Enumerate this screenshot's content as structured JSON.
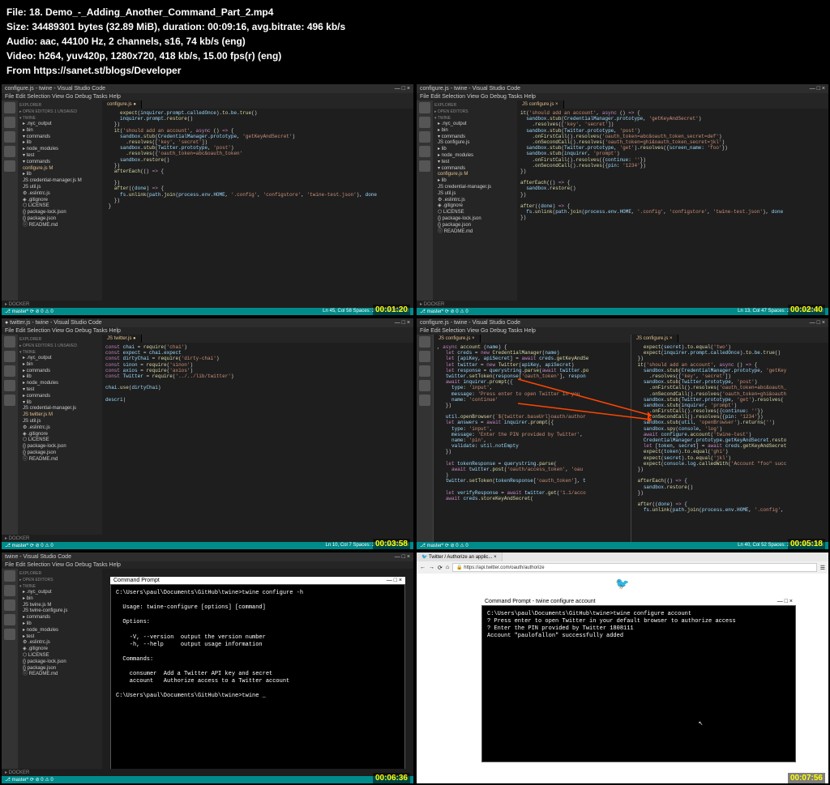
{
  "header": {
    "file": "18. Demo_-_Adding_Another_Command_Part_2.mp4",
    "size": "34489301 bytes (32.89 MiB), duration: 00:09:16, avg.bitrate: 496 kb/s",
    "audio": "aac, 44100 Hz, 2 channels, s16, 74 kb/s (eng)",
    "video": "h264, yuv420p, 1280x720, 418 kb/s, 15.00 fps(r) (eng)",
    "from": "https://sanet.st/blogs/Developer"
  },
  "panes": {
    "p1": {
      "title": "configure.js - twine - Visual Studio Code",
      "menu": "File  Edit  Selection  View  Go  Debug  Tasks  Help",
      "tab": "configure.js ●",
      "explorer": "EXPLORER",
      "sect1": "▸ OPEN EDITORS  1 UNSAVED",
      "sect2": "▾ TWINE",
      "tree": [
        "▸ .nyc_output",
        "▸ bin",
        "▾ commands",
        "▸ lib",
        "▸ node_modules",
        "▾ test",
        "  ▾ commands",
        "    configure.js    M",
        "  ▸ lib",
        "  JS credential-manager.js  M",
        "  JS util.js",
        "⚙ .eslintrc.js",
        "◈ .gitignore",
        "⬡ LICENSE",
        "{} package-lock.json",
        "{} package.json",
        "ⓘ README.md"
      ],
      "code": "     <span class='fn'>expect</span>(<span class='id'>inquirer</span>.<span class='id'>prompt</span>.<span class='id'>calledOnce</span>).<span class='fn'>to</span>.<span class='id'>be</span>.<span class='fn'>true</span>()\n     <span class='id'>inquirer</span>.<span class='id'>prompt</span>.<span class='fn'>restore</span>()\n   })\n   <span class='fn'>it</span>(<span class='str'>'should add an account'</span>, <span class='kw'>async</span> () <span class='kw'>=></span> {\n     <span class='id'>sandbox</span>.<span class='fn'>stub</span>(<span class='id'>CredentialManager</span>.<span class='id'>prototype</span>, <span class='str'>'getKeyAndSecret'</span>)\n       .<span class='fn'>resolves</span>([<span class='str'>'key'</span>, <span class='str'>'secret'</span>])\n     <span class='id'>sandbox</span>.<span class='fn'>stub</span>(<span class='id'>Twitter</span>.<span class='id'>prototype</span>, <span class='str'>'post'</span>)\n       .<span class='fn'>resolves</span>({<span class='str'>'oauth_token=abc&oauth_token'</span>\n     <span class='id'>sandbox</span>.<span class='fn'>restore</span>()\n   })\n   <span class='fn'>afterEach</span>(() <span class='kw'>=></span> {\n\n   })\n   <span class='fn'>after</span>((<span class='id'>done</span>) <span class='kw'>=></span> {\n     <span class='id'>fs</span>.<span class='fn'>unlink</span>(<span class='id'>path</span>.<span class='fn'>join</span>(<span class='id'>process</span>.<span class='id'>env</span>.<span class='id'>HOME</span>, <span class='str'>'.config'</span>, <span class='str'>'configstore'</span>, <span class='str'>'twine-test.json'</span>), <span class='id'>done</span>\n   })\n }",
      "status_l": "⎇ master* ⟳ ⊘ 0 ⚠ 0",
      "status_r": "Ln 45, Col 58   Spaces: 2  UTF-8  CRLF ☺",
      "docker": "▸ DOCKER",
      "ts": "00:01:20"
    },
    "p2": {
      "title": "configure.js - twine - Visual Studio Code",
      "menu": "File  Edit  Selection  View  Go  Debug  Tasks  Help",
      "tab": "JS configure.js ×",
      "explorer": "EXPLORER",
      "sect1": "▸ OPEN EDITORS",
      "sect2": "▾ TWINE",
      "tree": [
        "▸ .nyc_output",
        "▸ bin",
        "▾ commands",
        "  JS configure.js",
        "▸ lib",
        "▸ node_modules",
        "▾ test",
        "  ▾ commands",
        "    configure.js    M",
        "  ▸ lib",
        "  JS credential-manager.js",
        "  JS util.js",
        "⚙ .eslintrc.js",
        "◈ .gitignore",
        "⬡ LICENSE",
        "{} package-lock.json",
        "{} package.json",
        "ⓘ README.md"
      ],
      "code": "<span class='fn'>it</span>(<span class='str'>'should add an account'</span>, <span class='kw'>async</span> () <span class='kw'>=></span> {\n  <span class='id'>sandbox</span>.<span class='fn'>stub</span>(<span class='id'>CredentialManager</span>.<span class='id'>prototype</span>, <span class='str'>'getKeyAndSecret'</span>)\n    .<span class='fn'>resolves</span>([<span class='str'>'key'</span>, <span class='str'>'secret'</span>])\n  <span class='id'>sandbox</span>.<span class='fn'>stub</span>(<span class='id'>Twitter</span>.<span class='id'>prototype</span>, <span class='str'>'post'</span>)\n    .<span class='fn'>onFirstCall</span>().<span class='fn'>resolves</span>(<span class='str'>'oauth_token=abc&oauth_token_secret=def'</span>)\n    .<span class='fn'>onSecondCall</span>().<span class='fn'>resolves</span>(<span class='str'>'oauth_token=ghi&oauth_token_secret=jkl'</span>)\n  <span class='id'>sandbox</span>.<span class='fn'>stub</span>(<span class='id'>Twitter</span>.<span class='id'>prototype</span>, <span class='str'>'get'</span>).<span class='fn'>resolves</span>({<span class='id'>screen_name</span>: <span class='str'>'foo'</span>})\n  <span class='id'>sandbox</span>.<span class='fn'>stub</span>(<span class='id'>inquirer</span>, <span class='str'>'prompt'</span>)\n    .<span class='fn'>onFirstCall</span>().<span class='fn'>resolves</span>({<span class='id'>continue</span>: <span class='str'>''</span>})\n    .<span class='fn'>onSecondCall</span>().<span class='fn'>resolves</span>({<span class='id'>pin</span>: <span class='str'>'1234'</span>})\n})\n\n<span class='fn'>afterEach</span>(() <span class='kw'>=></span> {\n  <span class='id'>sandbox</span>.<span class='fn'>restore</span>()\n})\n\n<span class='fn'>after</span>((<span class='id'>done</span>) <span class='kw'>=></span> {\n  <span class='id'>fs</span>.<span class='fn'>unlink</span>(<span class='id'>path</span>.<span class='fn'>join</span>(<span class='id'>process</span>.<span class='id'>env</span>.<span class='id'>HOME</span>, <span class='str'>'.config'</span>, <span class='str'>'configstore'</span>, <span class='str'>'twine-test.json'</span>), <span class='id'>done</span>\n})",
      "status_l": "⎇ master* ⟳ ⊘ 0 ⚠ 0",
      "status_r": "Ln 13, Col 47   Spaces: 2  UTF-8  CRLF ☺",
      "docker": "▸ DOCKER",
      "ts": "00:02:40"
    },
    "p3": {
      "title": "● twitter.js - twine - Visual Studio Code",
      "menu": "File  Edit  Selection  View  Go  Debug  Tasks  Help",
      "tab": "JS twitter.js ●",
      "explorer": "EXPLORER",
      "sect1": "▸ OPEN EDITORS  1 UNSAVED",
      "sect2": "▾ TWINE",
      "tree": [
        "▸ .nyc_output",
        "▸ bin",
        "▸ commands",
        "▸ lib",
        "▸ node_modules",
        "▾ test",
        "  ▸ commands",
        "  ▾ lib",
        "    JS credential-manager.js",
        "    JS twitter.js    M",
        "  JS util.js",
        "⚙ .eslintrc.js",
        "◈ .gitignore",
        "⬡ LICENSE",
        "{} package-lock.json",
        "{} package.json",
        "ⓘ README.md"
      ],
      "code": "<span class='kw'>const</span> <span class='id'>chai</span> = <span class='fn'>require</span>(<span class='str'>'chai'</span>)\n<span class='kw'>const</span> <span class='id'>expect</span> = <span class='id'>chai</span>.<span class='id'>expect</span>\n<span class='kw'>const</span> <span class='id'>dirtyChai</span> = <span class='fn'>require</span>(<span class='str'>'dirty-chai'</span>)\n<span class='kw'>const</span> <span class='id'>sinon</span> = <span class='fn'>require</span>(<span class='str'>'sinon'</span>)\n<span class='kw'>const</span> <span class='id'>axios</span> = <span class='fn'>require</span>(<span class='str'>'axios'</span>)\n<span class='kw'>const</span> <span class='id'>Twitter</span> = <span class='fn'>require</span>(<span class='str'>'../../lib/twitter'</span>)\n\n<span class='id'>chai</span>.<span class='fn'>use</span>(<span class='id'>dirtyChai</span>)\n\n<span class='id'>descri</span>|",
      "status_l": "⎇ master* ⟳ ⊘ 0 ⚠ 0",
      "status_r": "Ln 10, Col 7   Spaces: 2  UTF-8  CRLF ☺",
      "docker": "▸ DOCKER",
      "ts": "00:03:58"
    },
    "p4": {
      "title": "configure.js - twine - Visual Studio Code",
      "menu": "File  Edit  Selection  View  Go  Debug  Tasks  Help",
      "tab1": "JS configure.js ×",
      "tab2": "JS configure.js ×",
      "code1": ", <span class='kw'>async</span> <span class='fn'>account</span> (<span class='id'>name</span>) {\n   <span class='kw'>let</span> <span class='id'>creds</span> = <span class='kw'>new</span> <span class='fn'>CredentialManager</span>(<span class='id'>name</span>)\n   <span class='kw'>let</span> [<span class='id'>apiKey</span>, <span class='id'>apiSecret</span>] = <span class='kw'>await</span> <span class='id'>creds</span>.<span class='fn'>getKeyAndSe</span>\n   <span class='kw'>let</span> <span class='id'>twitter</span> = <span class='kw'>new</span> <span class='fn'>Twitter</span>(<span class='id'>apiKey</span>, <span class='id'>apiSecret</span>)\n   <span class='kw'>let</span> <span class='id'>response</span> = <span class='id'>querystring</span>.<span class='fn'>parse</span>(<span class='kw'>await</span> <span class='id'>twitter</span>.<span class='fn'>po</span>\n   <span class='id'>twitter</span>.<span class='fn'>setToken</span>(<span class='id'>response</span>[<span class='str'>'oauth_token'</span>], <span class='id'>respon</span>\n   <span class='kw'>await</span> <span class='id'>inquirer</span>.<span class='fn'>prompt</span>({\n     <span class='id'>type</span>: <span class='str'>'input'</span>,\n     <span class='id'>message</span>: <span class='str'>'Press enter to open Twitter in you</span>\n     <span class='id'>name</span>: <span class='str'>'continue'</span>\n   })\n\n   <span class='id'>util</span>.<span class='fn'>openBrowser</span>(<span class='str'>`${twitter.baseUrl}oauth/author</span>\n   <span class='kw'>let</span> <span class='id'>answers</span> = <span class='kw'>await</span> <span class='id'>inquirer</span>.<span class='fn'>prompt</span>({\n     <span class='id'>type</span>: <span class='str'>'input'</span>,\n     <span class='id'>message</span>: <span class='str'>'Enter the PIN provided by Twitter'</span>,\n     <span class='id'>name</span>: <span class='str'>'pin'</span>,\n     <span class='id'>validate</span>: <span class='id'>util</span>.<span class='id'>notEmpty</span>\n   })\n\n   <span class='kw'>let</span> <span class='id'>tokenResponse</span> = <span class='id'>querystring</span>.<span class='fn'>parse</span>(\n     <span class='kw'>await</span> <span class='id'>twitter</span>.<span class='fn'>post</span>(<span class='str'>'oauth/access_token'</span>, <span class='str'>'oau</span>\n   )\n   <span class='id'>twitter</span>.<span class='fn'>setToken</span>(<span class='id'>tokenResponse</span>[<span class='str'>'oauth_token'</span>], <span class='id'>t</span>\n\n   <span class='kw'>let</span> <span class='id'>verifyResponse</span> = <span class='kw'>await</span> <span class='id'>twitter</span>.<span class='fn'>get</span>(<span class='str'>'1.1/acco</span>\n   <span class='kw'>await</span> <span class='id'>creds</span>.<span class='fn'>storeKeyAndSecret</span>(",
      "code2": "   <span class='fn'>expect</span>(<span class='id'>secret</span>).<span class='fn'>to</span>.<span class='fn'>equal</span>(<span class='str'>'two'</span>)\n   <span class='fn'>expect</span>(<span class='id'>inquirer</span>.<span class='id'>prompt</span>.<span class='id'>calledOnce</span>).<span class='fn'>to</span>.<span class='id'>be</span>.<span class='fn'>true</span>()\n })\n <span class='fn'>it</span>(<span class='str'>'should add an account'</span>, <span class='kw'>async</span> () <span class='kw'>=></span> {\n   <span class='id'>sandbox</span>.<span class='fn'>stub</span>(<span class='id'>CredentialManager</span>.<span class='id'>prototype</span>, <span class='str'>'getKey</span>\n     .<span class='fn'>resolves</span>([<span class='str'>'key'</span>, <span class='str'>'secret'</span>])\n   <span class='id'>sandbox</span>.<span class='fn'>stub</span>(<span class='id'>Twitter</span>.<span class='id'>prototype</span>, <span class='str'>'post'</span>)\n     .<span class='fn'>onFirstCall</span>().<span class='fn'>resolves</span>(<span class='str'>'oauth_token=abc&oauth_</span>\n     .<span class='fn'>onSecondCall</span>().<span class='fn'>resolves</span>(<span class='str'>'oauth_token=ghi&oauth</span>\n   <span class='id'>sandbox</span>.<span class='fn'>stub</span>(<span class='id'>Twitter</span>.<span class='id'>prototype</span>, <span class='str'>'get'</span>).<span class='fn'>resolves</span>(\n   <span class='id'>sandbox</span>.<span class='fn'>stub</span>(<span class='id'>inquirer</span>, <span class='str'>'prompt'</span>)\n     .<span class='fn'>onFirstCall</span>().<span class='fn'>resolves</span>({<span class='id'>continue</span>: <span class='str'>''</span>})\n     .<span class='fn'>onSecondCall</span>().<span class='fn'>resolves</span>({<span class='id'>pin</span>: <span class='str'>'1234'</span>})\n   <span class='id'>sandbox</span>.<span class='fn'>stub</span>(<span class='id'>util</span>, <span class='str'>'openBrowser'</span>).<span class='fn'>returns</span>(<span class='str'>''</span>)\n   <span class='id'>sandbox</span>.<span class='fn'>spy</span>(<span class='id'>console</span>, <span class='str'>'log'</span>)\n   <span class='kw'>await</span> <span class='id'>configure</span>.<span class='fn'>account</span>(<span class='str'>'twine-test'</span>)\n   <span class='id'>CredentialManager</span>.<span class='id'>prototype</span>.<span class='id'>getKeyAndSecret</span>.<span class='fn'>resto</span>\n   <span class='kw'>let</span> [<span class='id'>token</span>, <span class='id'>secret</span>] = <span class='kw'>await</span> <span class='id'>creds</span>.<span class='fn'>getKeyAndSecret</span>\n   <span class='fn'>expect</span>(<span class='id'>token</span>).<span class='fn'>to</span>.<span class='fn'>equal</span>(<span class='str'>'ghi'</span>)\n   <span class='fn'>expect</span>(<span class='id'>secret</span>).<span class='fn'>to</span>.<span class='fn'>equal</span>(<span class='str'>'jkl'</span>)\n   <span class='fn'>expect</span>(<span class='id'>console</span>.<span class='id'>log</span>.<span class='fn'>calledWith</span>(<span class='str'>'Account \"foo\" succ</span>\n })\n\n <span class='fn'>afterEach</span>(() <span class='kw'>=></span> {\n   <span class='id'>sandbox</span>.<span class='fn'>restore</span>()\n })\n\n <span class='fn'>after</span>((<span class='id'>done</span>) <span class='kw'>=></span> {\n   <span class='id'>fs</span>.<span class='fn'>unlink</span>(<span class='id'>path</span>.<span class='fn'>join</span>(<span class='id'>process</span>.<span class='id'>env</span>.<span class='id'>HOME</span>, <span class='str'>'.config'</span>,",
      "status_l": "⎇ master* ⟳ ⊘ 0 ⚠ 0",
      "status_r": "Ln 40, Col 52   Spaces: 2  UTF-8  CRLF ☺",
      "ts": "00:05:18"
    },
    "p5": {
      "title": "twine - Visual Studio Code",
      "menu": "File  Edit  Selection  View  Go  Debug  Tasks  Help",
      "explorer": "EXPLORER",
      "sect1": "▸ OPEN EDITORS",
      "sect2": "▾ TWINE",
      "tree": [
        "▸ .nyc_output",
        "▸ bin",
        "  JS twine.js    M",
        "  JS twine-configure.js",
        "▸ commands",
        "▸ lib",
        "▸ node_modules",
        "▸ test",
        "⚙ .eslintrc.js",
        "◈ .gitignore",
        "⬡ LICENSE",
        "{} package-lock.json",
        "{} package.json",
        "ⓘ README.md"
      ],
      "cmdtitle": "Command Prompt",
      "cmd": "C:\\Users\\paul\\Documents\\GitHub\\twine>twine configure -h\n\n  Usage: twine-configure [options] [command]\n\n  Options:\n\n    -V, --version  output the version number\n    -h, --help     output usage information\n\n  Commands:\n\n    consumer  Add a Twitter API key and secret\n    account   Authorize access to a Twitter account\n\nC:\\Users\\paul\\Documents\\GitHub\\twine>twine _",
      "status_l": "⎇ master* ⟳ ⊘ 0 ⚠ 0",
      "docker": "▸ DOCKER",
      "ts": "00:06:36"
    },
    "p6": {
      "btab": "🐦 Twitter / Authorize an applic... ×",
      "url": "🔒 https://api.twitter.com/oauth/authorize",
      "cmdtitle": "Command Prompt - twine  configure account",
      "cmd": "C:\\Users\\paul\\Documents\\GitHub\\twine>twine configure account\n? Press enter to open Twitter in your default browser to authorize access\n? Enter the PIN provided by Twitter 1808111\nAccount \"paulofallon\" successfully added\n\n\n\n\n\n\n\n\n\n\n\n                                                              ↖",
      "ts": "00:07:56"
    }
  }
}
